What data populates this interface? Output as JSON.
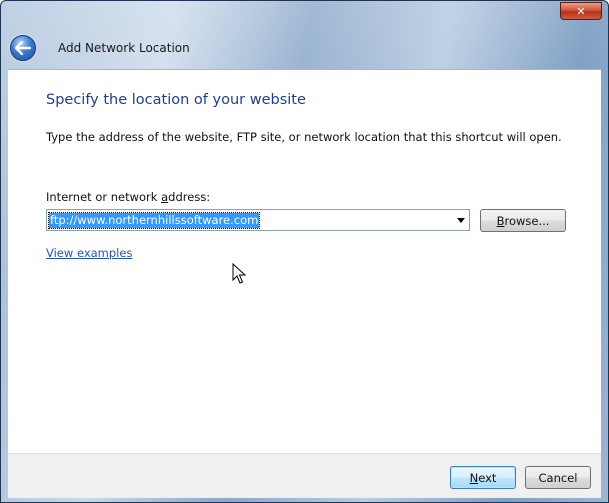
{
  "window": {
    "title": "Add Network Location",
    "close_glyph": "✕"
  },
  "content": {
    "heading": "Specify the location of your website",
    "description": "Type the address of the website, FTP site, or network location that this shortcut will open.",
    "address_label": "Internet or network address:",
    "address_value": "ftp://www.northernhillssoftware.com",
    "browse_label": "Browse...",
    "examples_link": "View examples"
  },
  "footer": {
    "next_label": "Next",
    "cancel_label": "Cancel"
  },
  "icons": {
    "back": "back-arrow-icon",
    "close": "close-icon",
    "dropdown": "dropdown-arrow-icon",
    "cursor": "mouse-pointer-icon"
  },
  "colors": {
    "heading": "#1f3f8f",
    "link": "#2255bb",
    "selection": "#3399ff",
    "close_button": "#c8442a"
  }
}
